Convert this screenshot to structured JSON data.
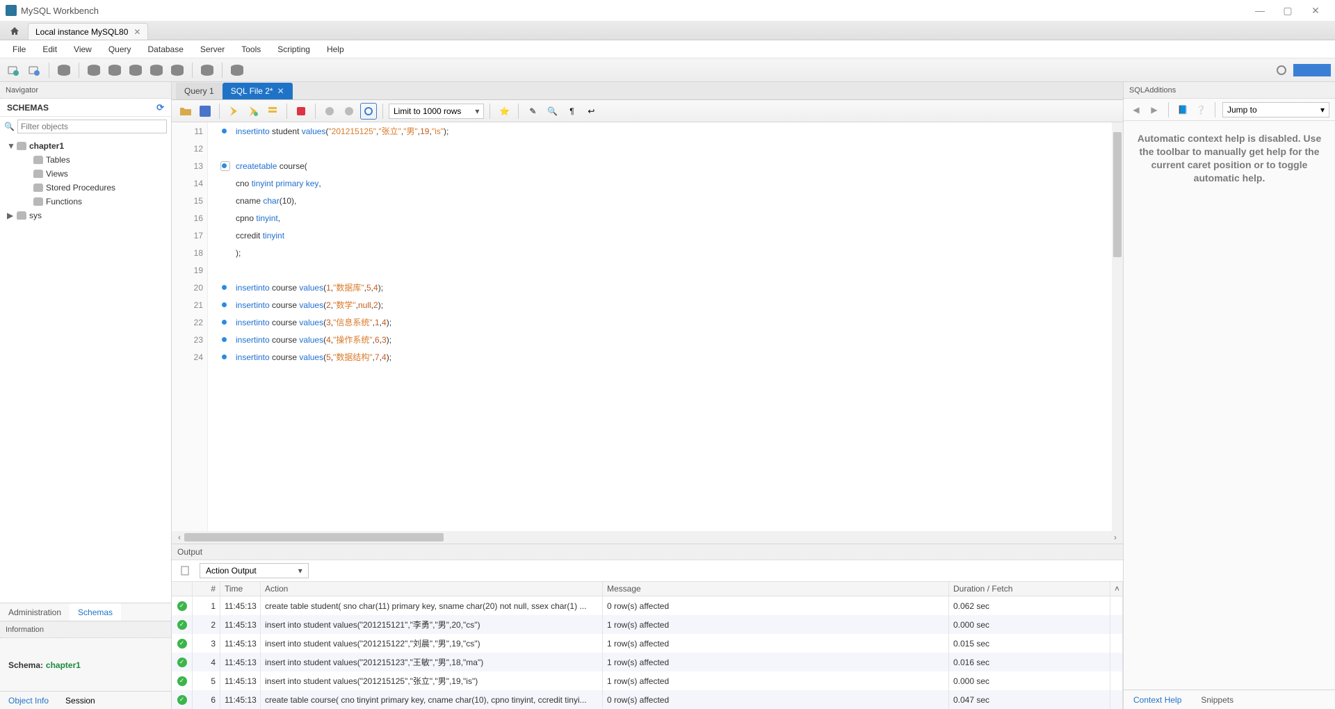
{
  "window": {
    "title": "MySQL Workbench",
    "win_min": "—",
    "win_max": "▢",
    "win_close": "✕"
  },
  "connection_tab": "Local instance MySQL80",
  "menu": [
    "File",
    "Edit",
    "View",
    "Query",
    "Database",
    "Server",
    "Tools",
    "Scripting",
    "Help"
  ],
  "navigator": {
    "panel": "Navigator",
    "header": "SCHEMAS",
    "filter_placeholder": "Filter objects",
    "items": {
      "chapter1": "chapter1",
      "tables": "Tables",
      "views": "Views",
      "sp": "Stored Procedures",
      "functions": "Functions",
      "sys": "sys"
    },
    "tabs": {
      "admin": "Administration",
      "schemas": "Schemas"
    },
    "info_label": "Information",
    "schema_label": "Schema:",
    "schema_value": "chapter1",
    "bottom": {
      "object": "Object Info",
      "session": "Session"
    }
  },
  "editor": {
    "tabs": {
      "q1": "Query 1",
      "file": "SQL File 2*"
    },
    "limit": "Limit to 1000 rows",
    "lines": {
      "11": {
        "kw1": "insert",
        "kw2": "into",
        "tbl": " student ",
        "kw3": "values",
        "s1": "\"201215125\"",
        "s2": "\"张立\"",
        "s3": "\"男\"",
        "n1": "19",
        "s4": "\"is\""
      },
      "13": {
        "kw1": "create",
        "kw2": "table",
        "tbl": " course("
      },
      "14": {
        "col": "cno ",
        "ty": "tinyint primary key",
        "p": ","
      },
      "15": {
        "col": "cname ",
        "ty": "char",
        "p": "(10),"
      },
      "16": {
        "col": "cpno ",
        "ty": "tinyint",
        "p": ","
      },
      "17": {
        "col": "ccredit ",
        "ty": "tinyint"
      },
      "18": {
        "p": ");"
      },
      "20": {
        "kw1": "insert",
        "kw2": "into",
        "tbl": " course ",
        "kw3": "values",
        "n1": "1",
        "s": "\"数据库\"",
        "n2": "5",
        "n3": "4"
      },
      "21": {
        "kw1": "insert",
        "kw2": "into",
        "tbl": " course ",
        "kw3": "values",
        "n1": "2",
        "s": "\"数学\"",
        "n2": "null",
        "n3": "2"
      },
      "22": {
        "kw1": "insert",
        "kw2": "into",
        "tbl": " course ",
        "kw3": "values",
        "n1": "3",
        "s": "\"信息系统\"",
        "n2": "1",
        "n3": "4"
      },
      "23": {
        "kw1": "insert",
        "kw2": "into",
        "tbl": " course ",
        "kw3": "values",
        "n1": "4",
        "s": "\"操作系统\"",
        "n2": "6",
        "n3": "3"
      },
      "24": {
        "kw1": "insert",
        "kw2": "into",
        "tbl": " course ",
        "kw3": "values",
        "n1": "5",
        "s": "\"数据结构\"",
        "n2": "7",
        "n3": "4"
      }
    }
  },
  "output": {
    "panel": "Output",
    "type": "Action Output",
    "head": {
      "num": "#",
      "time": "Time",
      "action": "Action",
      "msg": "Message",
      "dur": "Duration / Fetch"
    },
    "rows": [
      {
        "n": "1",
        "t": "11:45:13",
        "a": "create table student( sno char(11) primary key, sname char(20) not null, ssex char(1) ...",
        "m": "0 row(s) affected",
        "d": "0.062 sec"
      },
      {
        "n": "2",
        "t": "11:45:13",
        "a": "insert into student values(\"201215121\",\"李勇\",\"男\",20,\"cs\")",
        "m": "1 row(s) affected",
        "d": "0.000 sec"
      },
      {
        "n": "3",
        "t": "11:45:13",
        "a": "insert into student values(\"201215122\",\"刘晨\",\"男\",19,\"cs\")",
        "m": "1 row(s) affected",
        "d": "0.015 sec"
      },
      {
        "n": "4",
        "t": "11:45:13",
        "a": "insert into student values(\"201215123\",\"王敏\",\"男\",18,\"ma\")",
        "m": "1 row(s) affected",
        "d": "0.016 sec"
      },
      {
        "n": "5",
        "t": "11:45:13",
        "a": "insert into student values(\"201215125\",\"张立\",\"男\",19,\"is\")",
        "m": "1 row(s) affected",
        "d": "0.000 sec"
      },
      {
        "n": "6",
        "t": "11:45:13",
        "a": "create table course( cno tinyint primary key, cname char(10), cpno tinyint, ccredit tinyi...",
        "m": "0 row(s) affected",
        "d": "0.047 sec"
      }
    ]
  },
  "sqladd": {
    "panel": "SQLAdditions",
    "jump": "Jump to",
    "help": "Automatic context help is disabled. Use the toolbar to manually get help for the current caret position or to toggle automatic help.",
    "tabs": {
      "ctx": "Context Help",
      "snip": "Snippets"
    }
  }
}
